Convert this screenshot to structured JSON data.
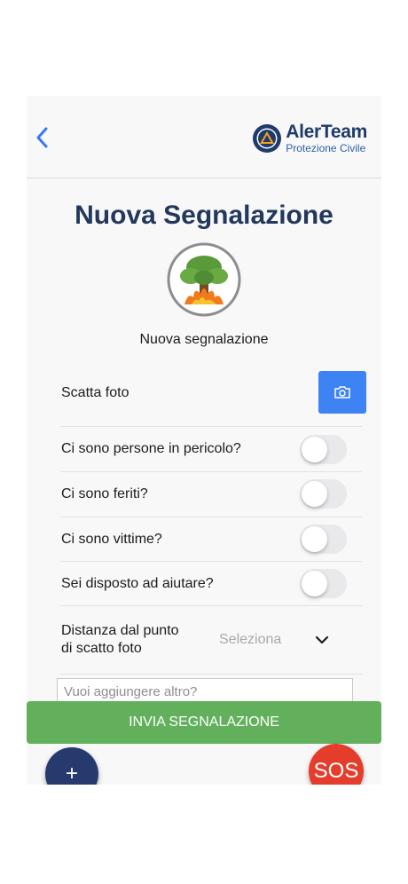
{
  "header": {
    "back_icon": "chevron-left-icon",
    "logo": {
      "title": "AlerTeam",
      "subtitle": "Protezione Civile"
    }
  },
  "page": {
    "title": "Nuova Segnalazione",
    "category_icon": "wildfire-tree-icon",
    "category_label": "Nuova segnalazione"
  },
  "form": {
    "photo": {
      "label": "Scatta foto",
      "button_icon": "camera-icon"
    },
    "toggles": [
      {
        "label": "Ci sono persone in pericolo?",
        "checked": false
      },
      {
        "label": "Ci sono feriti?",
        "checked": false
      },
      {
        "label": "Ci sono vittime?",
        "checked": false
      },
      {
        "label": "Sei disposto ad aiutare?",
        "checked": false
      }
    ],
    "distance": {
      "label_line1": "Distanza dal punto",
      "label_line2": "di scatto foto",
      "placeholder": "Seleziona"
    },
    "notes": {
      "placeholder": "Vuoi aggiungere altro?"
    }
  },
  "actions": {
    "submit_label": "INVIA SEGNALAZIONE",
    "add_label": "+",
    "sos_label": "SOS"
  },
  "colors": {
    "accent_blue": "#3e83f4",
    "title_navy": "#23385c",
    "submit_green": "#62b05c",
    "fab_navy": "#263a6d",
    "sos_red": "#e53d2c"
  }
}
